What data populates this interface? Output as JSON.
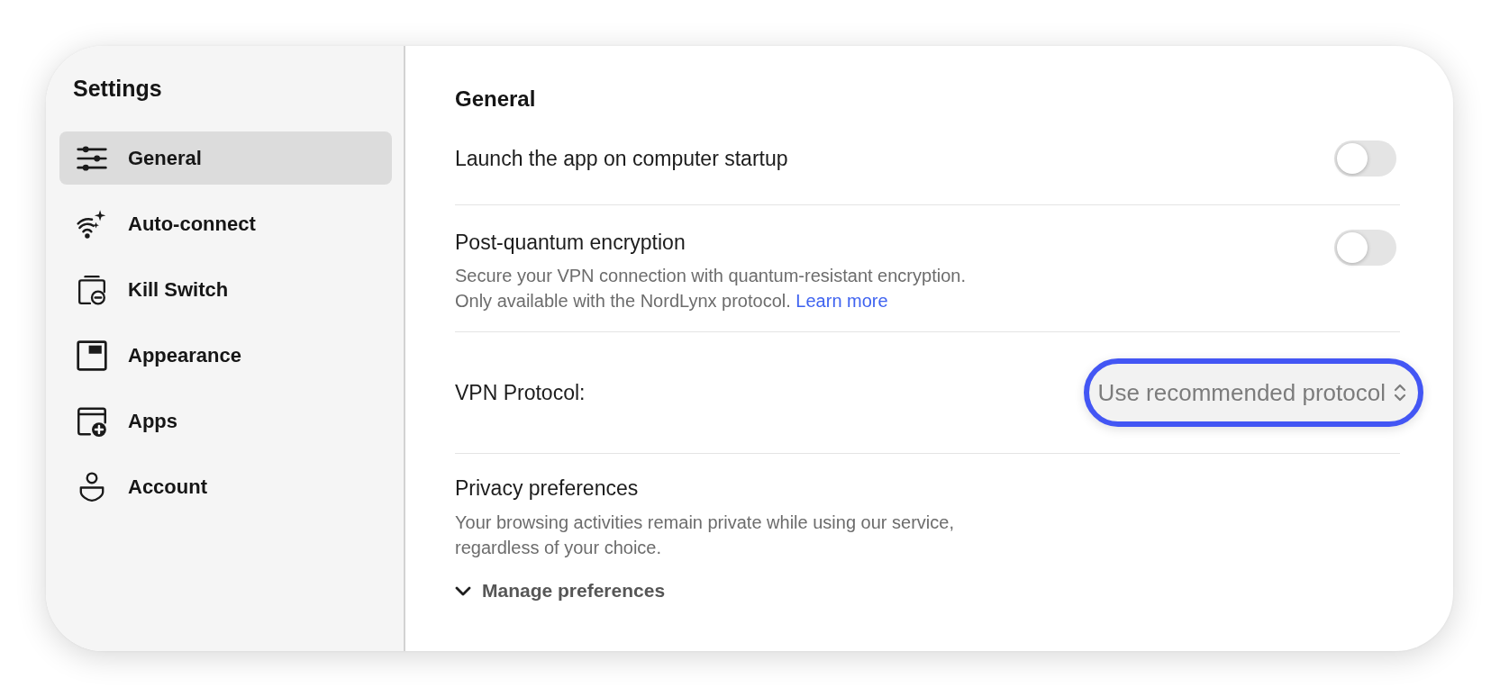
{
  "sidebar": {
    "title": "Settings",
    "items": [
      {
        "label": "General",
        "selected": true
      },
      {
        "label": "Auto-connect",
        "selected": false
      },
      {
        "label": "Kill Switch",
        "selected": false
      },
      {
        "label": "Appearance",
        "selected": false
      },
      {
        "label": "Apps",
        "selected": false
      },
      {
        "label": "Account",
        "selected": false
      }
    ]
  },
  "content": {
    "title": "General",
    "settings": [
      {
        "kind": "toggle",
        "label": "Launch the app on computer startup",
        "on": false
      },
      {
        "kind": "toggle",
        "label": "Post-quantum encryption",
        "on": false,
        "description_lines": [
          "Secure your VPN connection with quantum-resistant encryption.",
          "Only available with the NordLynx protocol."
        ],
        "link": "Learn more"
      },
      {
        "kind": "select",
        "label": "VPN Protocol:",
        "value": "Use recommended protocol",
        "focused": true
      },
      {
        "kind": "expander",
        "label": "Privacy preferences",
        "description_lines": [
          "Your browsing activities remain private while using our service,",
          "regardless of your choice."
        ],
        "action": "Manage preferences",
        "expanded": false
      }
    ]
  }
}
